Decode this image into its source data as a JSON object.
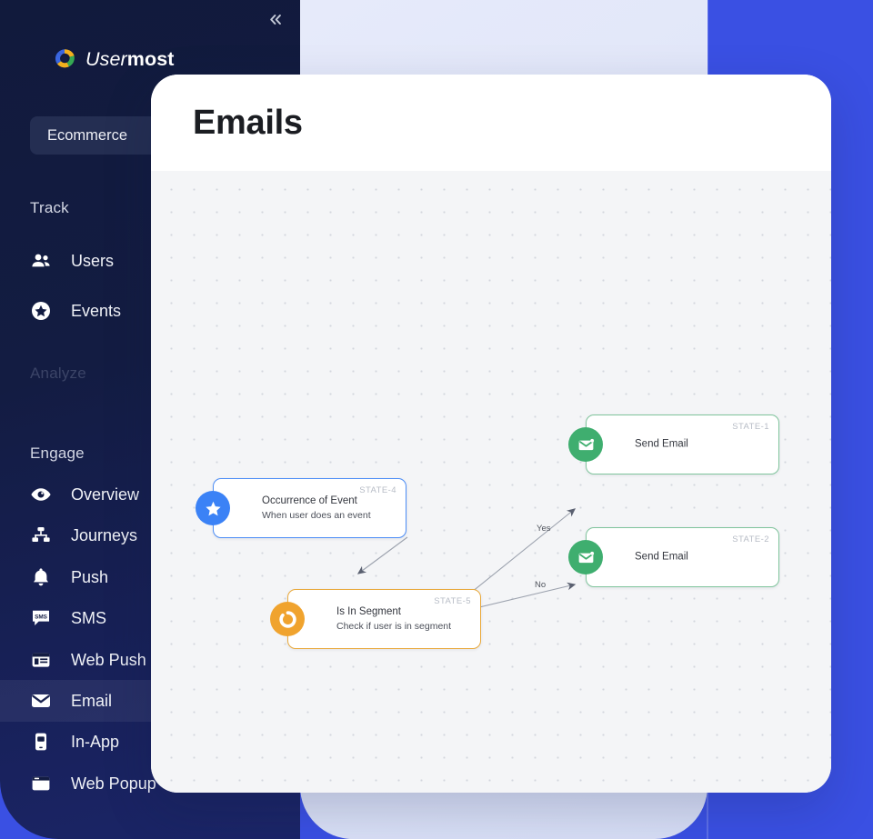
{
  "theme": {
    "page_bg": "#3A50E3",
    "panel_bg": "#E2E7F8",
    "sidebar_bg": "#131C42",
    "card_bg": "#FFFFFF",
    "canvas_bg": "#F4F5F7",
    "accent_blue": "#3B82F6",
    "accent_amber": "#F0A32E",
    "accent_green": "#3FAE6F"
  },
  "sidebar": {
    "collapse_icon": "chevron-double-left-icon",
    "brand": {
      "name_part1": "User",
      "name_part2": "most",
      "logo_icon": "usermost-pinwheel-logo"
    },
    "workspace": {
      "label": "Ecommerce"
    },
    "sections": [
      {
        "label": "Track",
        "dim": false
      },
      {
        "label": "Analyze",
        "dim": true
      },
      {
        "label": "Engage",
        "dim": false
      }
    ],
    "items": [
      {
        "label": "Users",
        "icon": "users-icon",
        "active": false
      },
      {
        "label": "Events",
        "icon": "star-circle-icon",
        "active": false
      },
      {
        "label": "Overview",
        "icon": "eye-icon",
        "active": false
      },
      {
        "label": "Journeys",
        "icon": "sitemap-icon",
        "active": false
      },
      {
        "label": "Push",
        "icon": "bell-icon",
        "active": false
      },
      {
        "label": "SMS",
        "icon": "sms-bubble-icon",
        "active": false
      },
      {
        "label": "Web Push",
        "icon": "browser-window-icon",
        "active": false
      },
      {
        "label": "Email",
        "icon": "envelope-icon",
        "active": true
      },
      {
        "label": "In-App",
        "icon": "mobile-phone-icon",
        "active": false
      },
      {
        "label": "Web Popup",
        "icon": "popup-window-icon",
        "active": false
      }
    ]
  },
  "header": {
    "title": "Emails"
  },
  "flow": {
    "nodes": [
      {
        "id": "STATE-4",
        "state_label": "STATE-4",
        "title": "Occurrence of Event",
        "subtitle": "When user does an event",
        "icon": "star-badge-icon",
        "color": "blue"
      },
      {
        "id": "STATE-5",
        "state_label": "STATE-5",
        "title": "Is In Segment",
        "subtitle": "Check if user is in segment",
        "icon": "segment-ring-icon",
        "color": "amber"
      },
      {
        "id": "STATE-1",
        "state_label": "STATE-1",
        "title": "Send Email",
        "subtitle": "",
        "icon": "envelope-send-icon",
        "color": "green"
      },
      {
        "id": "STATE-2",
        "state_label": "STATE-2",
        "title": "Send Email",
        "subtitle": "",
        "icon": "envelope-send-icon",
        "color": "green"
      }
    ],
    "edges": [
      {
        "from": "STATE-4",
        "to": "STATE-5",
        "label": ""
      },
      {
        "from": "STATE-5",
        "to": "STATE-1",
        "label": "Yes"
      },
      {
        "from": "STATE-5",
        "to": "STATE-2",
        "label": "No"
      }
    ]
  }
}
